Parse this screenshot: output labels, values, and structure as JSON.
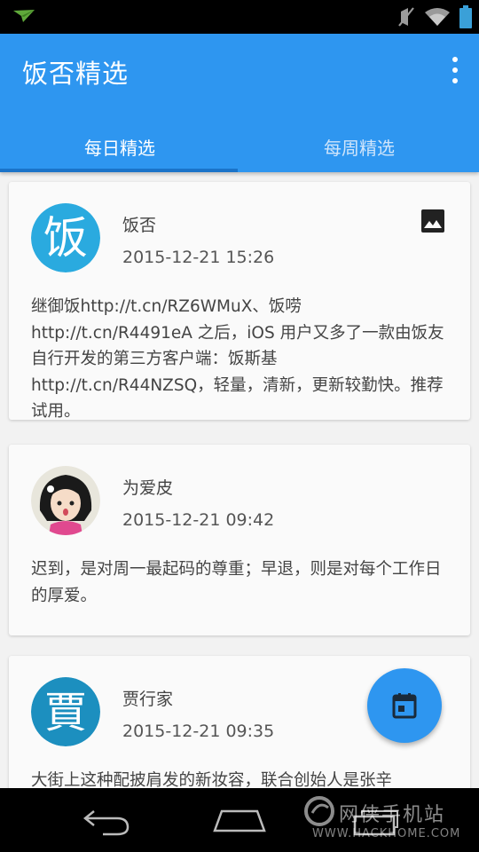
{
  "app": {
    "title": "饭否精选"
  },
  "tabs": [
    {
      "label": "每日精选",
      "active": true
    },
    {
      "label": "每周精选",
      "active": false
    }
  ],
  "posts": [
    {
      "author": "饭否",
      "time": "2015-12-21 15:26",
      "text": "继御饭http://t.cn/RZ6WMuX、饭唠http://t.cn/R4491eA 之后，iOS 用户又多了一款由饭友自行开发的第三方客户端：饭斯基http://t.cn/R44NZSQ，轻量，清新，更新较勤快。推荐试用。",
      "avatar_char": "饭",
      "has_image": true
    },
    {
      "author": "为爱皮",
      "time": "2015-12-21 09:42",
      "text": "迟到，是对周一最起码的尊重；早退，则是对每个工作日的厚爱。",
      "has_image": false
    },
    {
      "author": "贾行家",
      "time": "2015-12-21 09:35",
      "text": "大街上这种配披肩发的新妆容，联合创始人是张辛",
      "avatar_char": "賈",
      "has_image": false
    }
  ],
  "watermark": {
    "cn": "网侠手机站",
    "en": "WWW.HACKHOME.COM"
  },
  "colors": {
    "primary": "#2e96f0",
    "indicator": "#1a73c9",
    "card": "#fafafa",
    "background": "#f2f2f2"
  },
  "icons": {
    "status": [
      "paper-plane-icon",
      "mute-icon",
      "wifi-icon",
      "battery-icon"
    ],
    "overflow": "more-vert-icon",
    "image": "image-icon",
    "fab": "calendar-icon",
    "nav": [
      "back-icon",
      "home-icon",
      "recent-apps-icon"
    ]
  }
}
